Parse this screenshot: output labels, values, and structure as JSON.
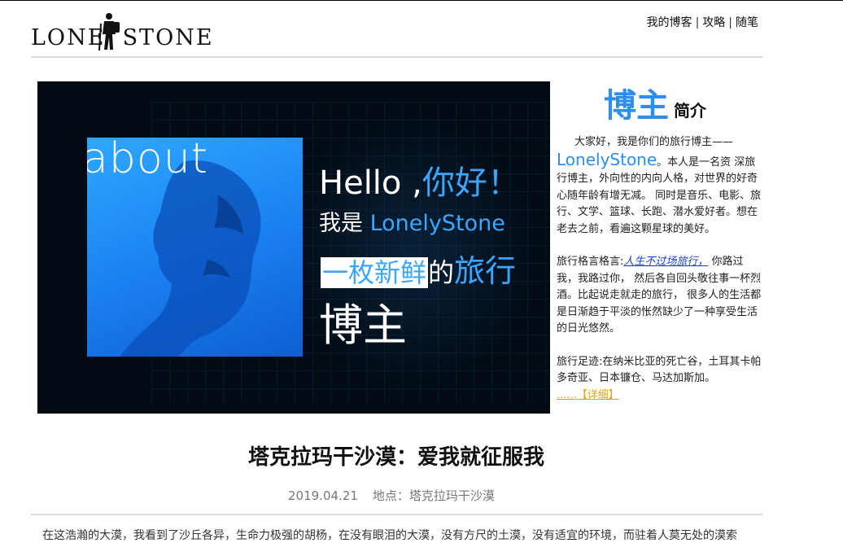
{
  "header": {
    "logo_text": "LONE  STONE",
    "nav": [
      "我的博客",
      "攻略",
      "随笔"
    ]
  },
  "hero": {
    "photo_word": "about",
    "hello": "Hello ,",
    "hello_cn": "你好",
    "hello_ex": "！",
    "iam": "我是 ",
    "iam_name": "LonelyStone",
    "fresh_box": "一枚新鲜",
    "fresh_de": "的",
    "fresh_travel": "旅行",
    "blogger": "博主"
  },
  "sidebar": {
    "title_big": "博主",
    "title_small": "简介",
    "intro_pre": "大家好，我是你们的旅行博主——",
    "intro_name": "LonelyStone",
    "intro_post": "。本人是一名资 深旅行博主，外向性的内向人格，对世界的好奇心随年龄有增无减。 同时是音乐、电影、旅行、文学、篮球、长跑、潜水爱好者。想在老去之前，看遍这颗星球的美好。",
    "motto_label": "旅行格言格言:",
    "motto_link": "人生不过场旅行，",
    "motto_text": " 你路过我，我路过你， 然后各自回头敬往事一杯烈酒。比起说走就走的旅行， 很多人的生活都是日渐趋于平淡的怅然缺少了一种享受生活的日光悠然。",
    "footprint": "旅行足迹:在纳米比亚的死亡谷，土耳其卡帕多奇亚、日本镰仓、马达加斯加。",
    "detail_link": "......【详细】"
  },
  "post": {
    "title": "塔克拉玛干沙漠：爱我就征服我",
    "date": "2019.04.21",
    "location": "地点：塔克拉玛干沙漠",
    "excerpt": "在这浩瀚的大漠，我看到了沙丘各异，生命力极强的胡杨，在没有眼泪的大漠，没有方尺的土漠，没有适宜的环境，而驻着人莫无处的漠索"
  }
}
